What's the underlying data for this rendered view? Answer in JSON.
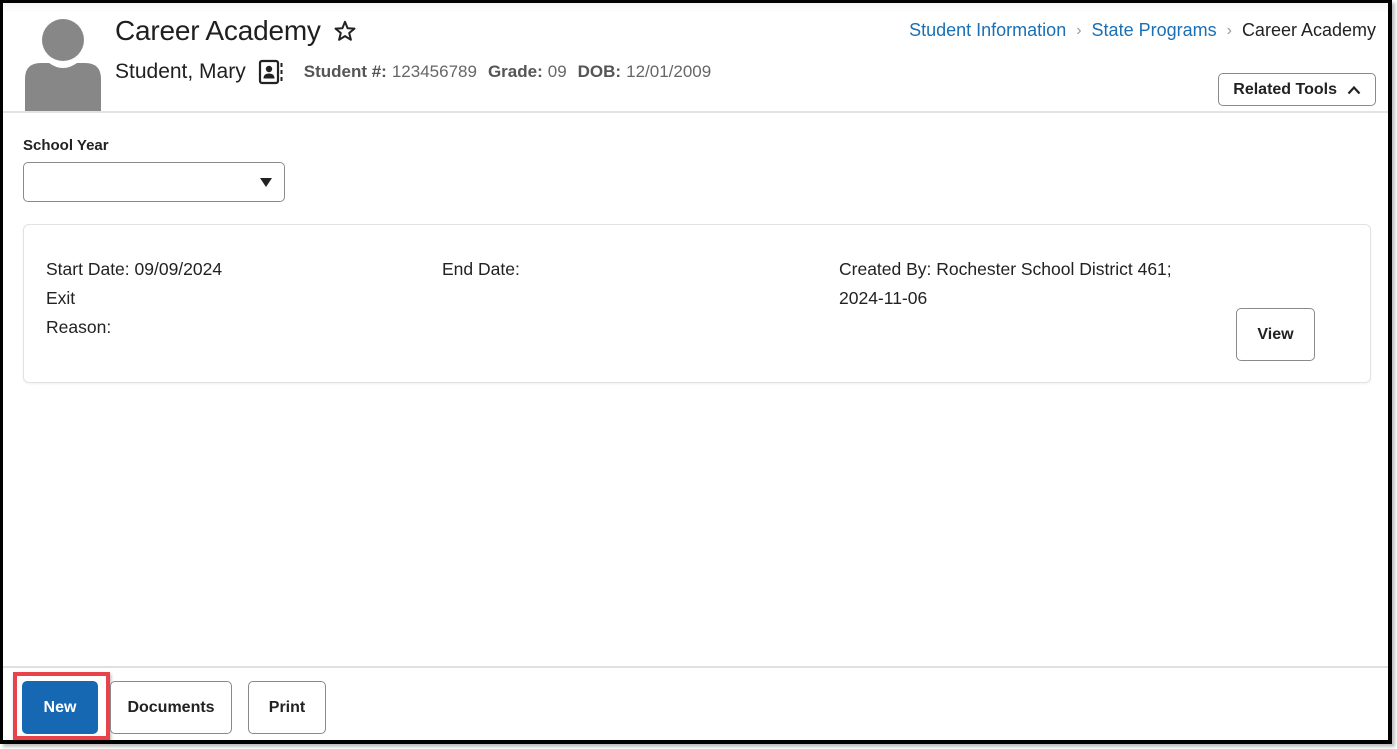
{
  "header": {
    "title": "Career Academy",
    "favorite_icon": "star-outline-icon",
    "student_name": "Student, Mary",
    "contact_icon": "contact-card-icon",
    "meta": [
      {
        "label": "Student #:",
        "value": "123456789"
      },
      {
        "label": "Grade:",
        "value": "09"
      },
      {
        "label": "DOB:",
        "value": "12/01/2009"
      }
    ],
    "breadcrumb": [
      {
        "label": "Student Information",
        "link": true
      },
      {
        "label": "State Programs",
        "link": true
      },
      {
        "label": "Career Academy",
        "link": false
      }
    ],
    "related_tools_label": "Related Tools",
    "related_tools_icon": "chevron-up-icon"
  },
  "filters": {
    "school_year_label": "School Year",
    "school_year_value": ""
  },
  "record": {
    "start_date": "Start Date: 09/09/2024",
    "exit_reason_line1": "Exit",
    "exit_reason_line2": "Reason:",
    "end_date": "End Date:",
    "created_by_line1": "Created By: Rochester School District 461;",
    "created_by_line2": "2024-11-06",
    "view_label": "View"
  },
  "footer": {
    "new_label": "New",
    "documents_label": "Documents",
    "print_label": "Print"
  },
  "colors": {
    "primary": "#1668b3",
    "link": "#1a6fb5",
    "highlight": "#e8424a"
  }
}
